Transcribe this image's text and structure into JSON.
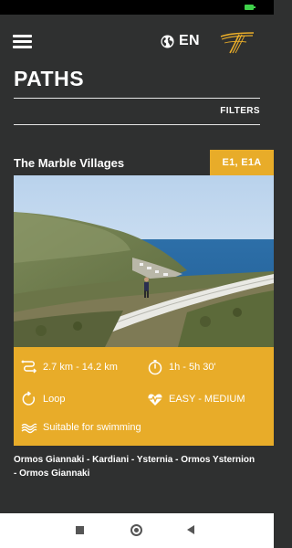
{
  "header": {
    "language": "EN",
    "page_title": "PATHS",
    "filters_label": "FILTERS"
  },
  "card": {
    "title": "The Marble Villages",
    "route_codes": "E1, E1A",
    "distance": "2.7 km - 14.2 km",
    "duration": "1h - 5h 30'",
    "path_type": "Loop",
    "difficulty": "EASY - MEDIUM",
    "swimming": "Suitable for swimming",
    "route": "Ormos Giannaki - Kardiani - Ysternia - Ormos Ysternion - Ormos Giannaki"
  },
  "colors": {
    "background": "#2f3030",
    "accent": "#e8ac29",
    "text": "#ffffff"
  },
  "icons": {
    "menu": "hamburger-menu-icon",
    "language": "globe-icon",
    "logo": "app-logo",
    "distance": "route-squiggle-icon",
    "duration": "stopwatch-icon",
    "path_type": "loop-arrow-icon",
    "difficulty": "heartbeat-icon",
    "swimming": "waves-icon"
  }
}
